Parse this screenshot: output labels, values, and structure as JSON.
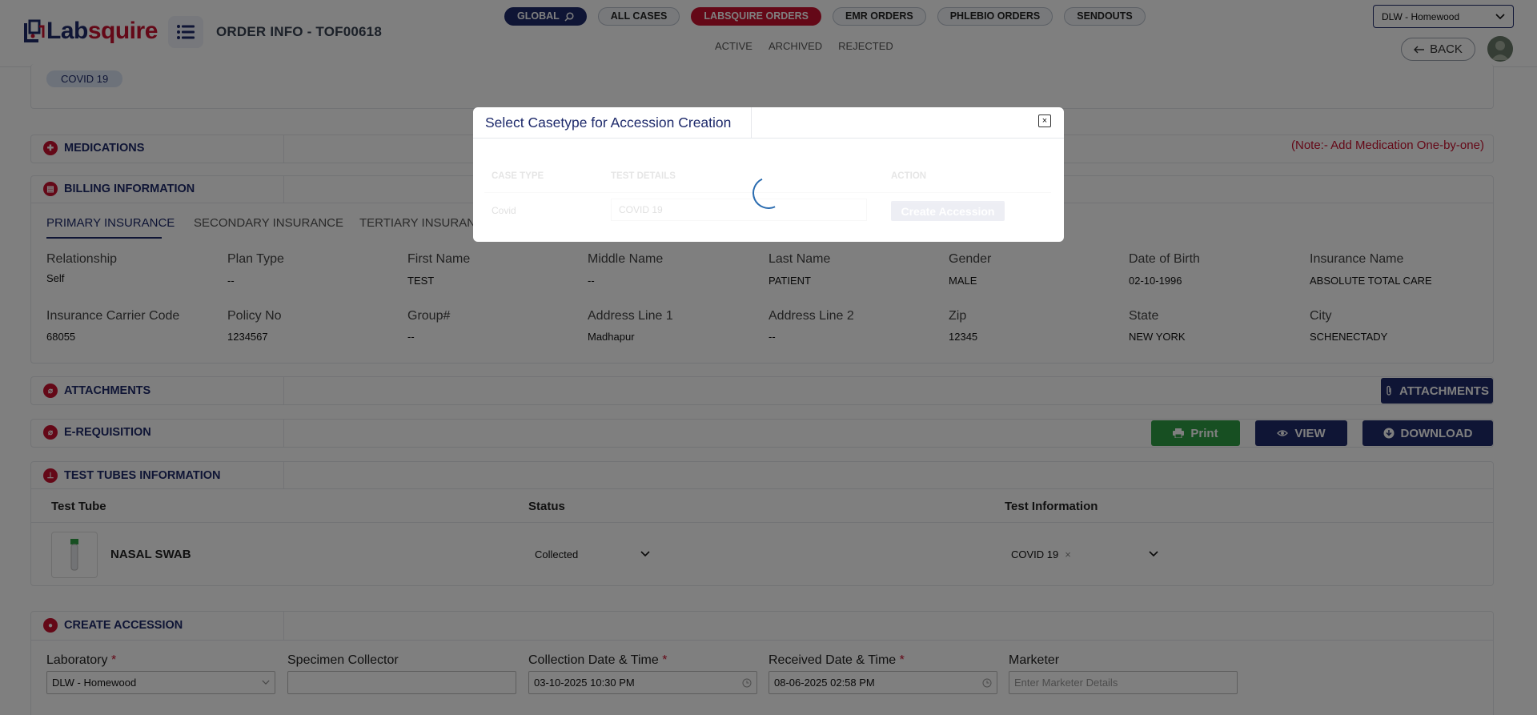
{
  "header": {
    "logo_text_main": "Lab",
    "logo_text_accent": "squire",
    "page_title": "ORDER INFO - TOF00618",
    "nav_pills": [
      {
        "label": "GLOBAL"
      },
      {
        "label": "ALL CASES"
      },
      {
        "label": "LABSQUIRE ORDERS"
      },
      {
        "label": "EMR ORDERS"
      },
      {
        "label": "PHLEBIO ORDERS"
      },
      {
        "label": "SENDOUTS"
      }
    ],
    "subnav": [
      "ACTIVE",
      "ARCHIVED",
      "REJECTED"
    ],
    "lab_select_value": "DLW - Homewood",
    "back_label": "BACK"
  },
  "test_chip": "COVID 19",
  "medications": {
    "title": "MEDICATIONS",
    "note": "(Note:- Add Medication One-by-one)"
  },
  "billing": {
    "title": "BILLING INFORMATION",
    "tabs": [
      "PRIMARY INSURANCE",
      "SECONDARY INSURANCE",
      "TERTIARY INSURANCE"
    ],
    "fields_row1": [
      {
        "label": "Relationship",
        "value": "Self"
      },
      {
        "label": "Plan Type",
        "value": "--"
      },
      {
        "label": "First Name",
        "value": "TEST"
      },
      {
        "label": "Middle Name",
        "value": "--"
      },
      {
        "label": "Last Name",
        "value": "PATIENT"
      },
      {
        "label": "Gender",
        "value": "MALE"
      },
      {
        "label": "Date of Birth",
        "value": "02-10-1996"
      },
      {
        "label": "Insurance Name",
        "value": "ABSOLUTE TOTAL CARE"
      }
    ],
    "fields_row2": [
      {
        "label": "Insurance Carrier Code",
        "value": "68055"
      },
      {
        "label": "Policy No",
        "value": "1234567"
      },
      {
        "label": "Group#",
        "value": "--"
      },
      {
        "label": "Address Line 1",
        "value": "Madhapur"
      },
      {
        "label": "Address Line 2",
        "value": "--"
      },
      {
        "label": "Zip",
        "value": "12345"
      },
      {
        "label": "State",
        "value": "NEW YORK"
      },
      {
        "label": "City",
        "value": "SCHENECTADY"
      }
    ]
  },
  "attachments": {
    "title": "ATTACHMENTS",
    "button_label": "ATTACHMENTS"
  },
  "erequisition": {
    "title": "E-REQUISITION",
    "print_label": "Print",
    "view_label": "VIEW",
    "download_label": "DOWNLOAD"
  },
  "test_tubes": {
    "title": "TEST TUBES INFORMATION",
    "columns": [
      "Test Tube",
      "Status",
      "Test Information"
    ],
    "rows": [
      {
        "tube": "NASAL SWAB",
        "status": "Collected",
        "test": "COVID 19"
      }
    ]
  },
  "create_accession": {
    "title": "CREATE ACCESSION",
    "fields": [
      {
        "label": "Laboratory",
        "required": "*",
        "value": "DLW - Homewood",
        "placeholder": ""
      },
      {
        "label": "Specimen Collector",
        "required": "",
        "value": "",
        "placeholder": ""
      },
      {
        "label": "Collection Date & Time",
        "required": "*",
        "value": "03-10-2025 10:30 PM",
        "placeholder": ""
      },
      {
        "label": "Received Date & Time",
        "required": "*",
        "value": "08-06-2025 02:58 PM",
        "placeholder": ""
      },
      {
        "label": "Marketer",
        "required": "",
        "value": "",
        "placeholder": "Enter Marketer Details"
      }
    ]
  },
  "modal": {
    "title": "Select Casetype for Accession Creation",
    "close_label": "×",
    "columns": [
      "CASE TYPE",
      "TEST DETAILS",
      "ACTION"
    ],
    "row": {
      "case_type": "Covid",
      "test": "COVID 19",
      "action_label": "Create Accession"
    }
  },
  "colors": {
    "navy": "#1e2a6b",
    "brand_red": "#c8102e",
    "green": "#2f9e44"
  }
}
